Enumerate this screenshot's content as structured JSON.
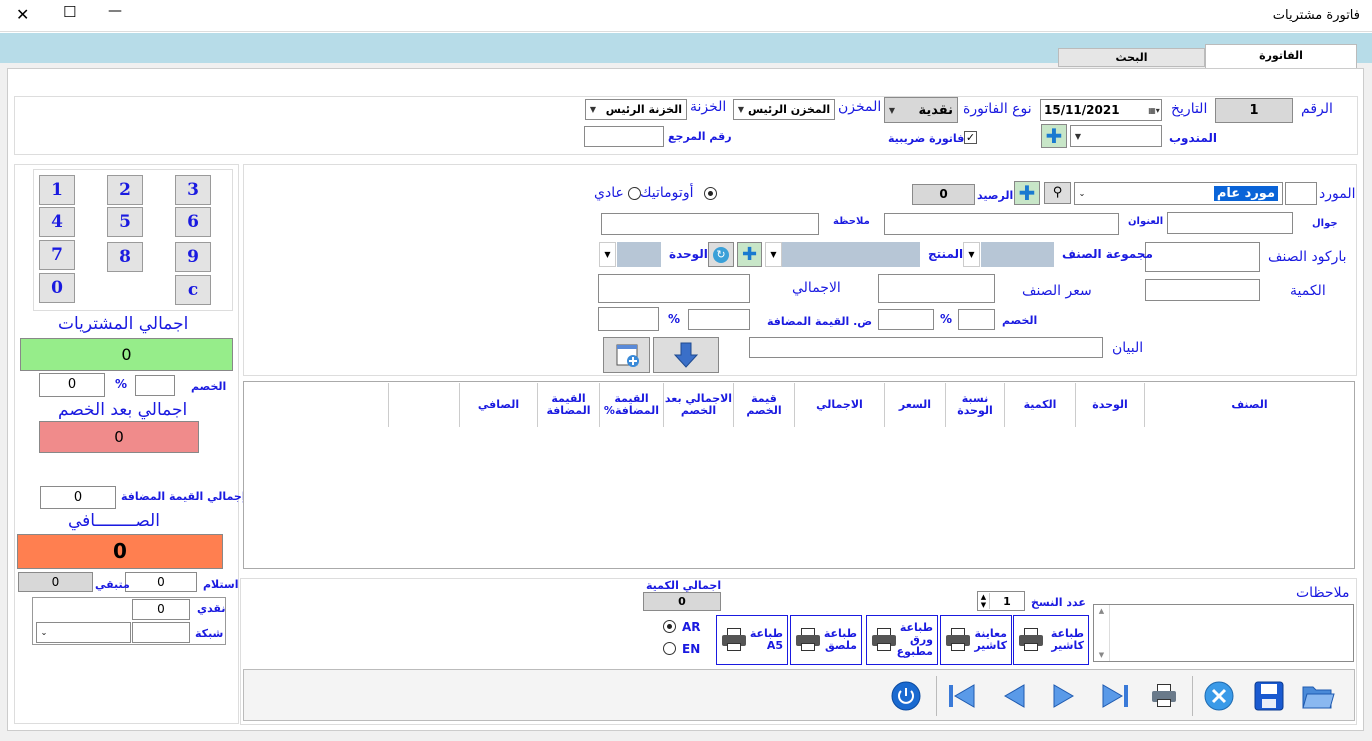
{
  "window": {
    "title": "فاتورة مشتريات",
    "min": "—",
    "max": "☐",
    "close": "✕"
  },
  "tabs": {
    "invoice": "الفاتورة",
    "search": "البحث"
  },
  "header": {
    "number_label": "الرقم",
    "number_value": "1",
    "date_label": "التاريخ",
    "date_value": "15/11/2021",
    "invoice_type_label": "نوع الفاتورة",
    "invoice_type_value": "نقدية",
    "store_label": "المخزن",
    "store_value": "المخزن الرئيس",
    "treasury_label": "الخزنة",
    "treasury_value": "الخزنة الرئيس",
    "rep_label": "المندوب",
    "tax_invoice_label": "فاتورة ضريبية",
    "ref_label": "رقم المرجع"
  },
  "keypad": [
    "1",
    "2",
    "3",
    "4",
    "5",
    "6",
    "7",
    "8",
    "9",
    "0",
    "c"
  ],
  "totals": {
    "purchases_label": "اجمالي المشتريات",
    "purchases_value": "0",
    "discount_label": "الخصم",
    "discount_value": "0",
    "percent": "%",
    "after_discount_label": "اجمالي بعد الخصم",
    "after_discount_value": "0",
    "vat_total_label": "إجمالي القيمة المضافة",
    "vat_total_value": "0",
    "net_label": "الصــــــــافي",
    "net_value": "0",
    "received_label": "استلام",
    "received_value": "0",
    "remaining_label": "متبقي",
    "remaining_value": "0",
    "cash_label": "نقدي",
    "cash_value": "0",
    "network_label": "شبكة"
  },
  "supplier": {
    "label": "المورد",
    "value": "مورد عام",
    "balance_label": "الرصيد",
    "balance_value": "0",
    "mode_auto": "أوتوماتيك",
    "mode_normal": "عادي",
    "mobile_label": "جوال",
    "address_label": "العنوان",
    "note_label": "ملاحظة"
  },
  "item": {
    "barcode_label": "باركود الصنف",
    "group_label": "مجموعة الصنف",
    "product_label": "المنتج",
    "unit_label": "الوحدة",
    "qty_label": "الكمية",
    "price_label": "سعر الصنف",
    "total_label": "الاجمالي",
    "discount_label": "الخصم",
    "vat_label": "ض. القيمة المضافة",
    "percent": "%",
    "desc_label": "البيان"
  },
  "table": {
    "columns": [
      "الصنف",
      "الوحدة",
      "الكمية",
      "نسبة الوحدة",
      "السعر",
      "الاجمالي",
      "قيمة الخصم",
      "الاجمالي بعد الخصم",
      "القيمة المضافة%",
      "القيمة المضافة",
      "الصافي",
      ""
    ]
  },
  "footer": {
    "qty_total_label": "اجمالي الكمية",
    "qty_total_value": "0",
    "copies_label": "عدد النسخ",
    "copies_value": "1",
    "notes_label": "ملاحظات",
    "lang_ar": "AR",
    "lang_en": "EN",
    "print_a5": "طباعة A5",
    "print_sticker": "طباعة ملصق",
    "print_preprinted": "طباعة ورق مطبوع",
    "preview_cashier": "معاينة كاشير",
    "print_cashier": "طباعة كاشير"
  },
  "colors": {
    "accent": "#1a1ae0",
    "band": "#b7dce8",
    "green": "#96ed8a",
    "pink": "#f08b8b",
    "orange": "#ff7f50"
  }
}
